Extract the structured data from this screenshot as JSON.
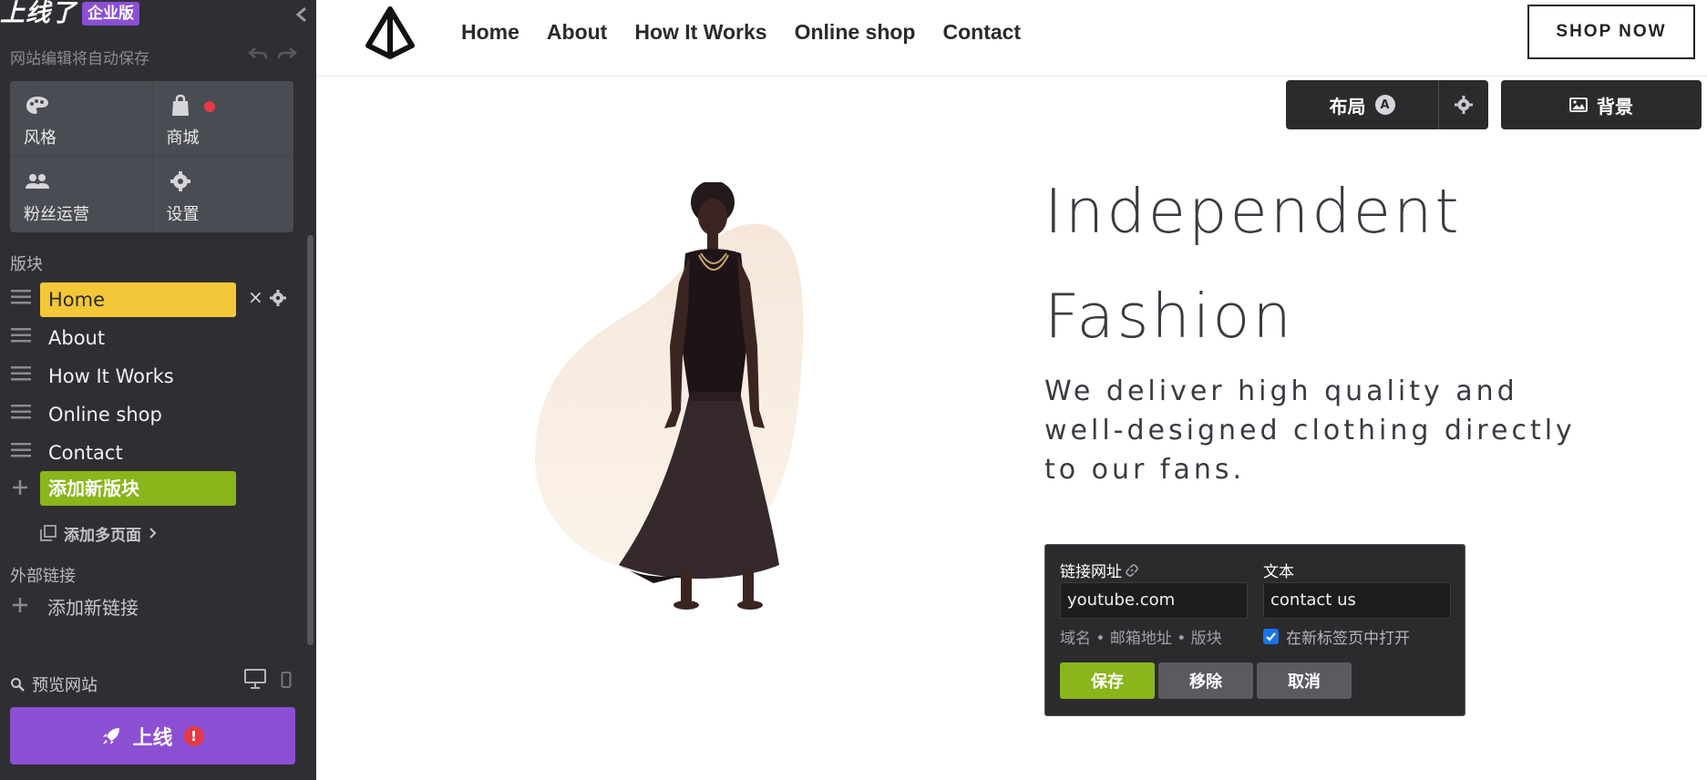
{
  "app": {
    "brand_name": "上线了",
    "brand_badge": "企业版",
    "autosave_text": "网站编辑将自动保存"
  },
  "tools": [
    {
      "label": "风格",
      "icon": "palette-icon"
    },
    {
      "label": "商城",
      "icon": "shopping-bag-icon",
      "notify": true
    },
    {
      "label": "粉丝运营",
      "icon": "people-icon"
    },
    {
      "label": "设置",
      "icon": "gear-icon"
    }
  ],
  "sections": {
    "blocks_label": "版块",
    "external_links_label": "外部链接"
  },
  "blocks": [
    {
      "label": "Home",
      "active": true
    },
    {
      "label": "About"
    },
    {
      "label": "How It Works"
    },
    {
      "label": "Online shop"
    },
    {
      "label": "Contact"
    }
  ],
  "actions": {
    "add_block": "添加新版块",
    "add_page": "添加多页面",
    "add_link": "添加新链接",
    "preview": "预览网站",
    "publish": "上线",
    "publish_alert": "!"
  },
  "site": {
    "nav": [
      "Home",
      "About",
      "How It Works",
      "Online shop",
      "Contact"
    ],
    "shop_now": "SHOP NOW",
    "layout_label": "布局",
    "layout_badge": "A",
    "background_label": "背景",
    "hero_title_line1": "Independent",
    "hero_title_line2": "Fashion",
    "hero_subtitle": "We deliver high quality and well-designed clothing directly to our fans."
  },
  "link_editor": {
    "url_label": "链接网址",
    "url_value": "youtube.com",
    "text_label": "文本",
    "text_value": "contact us",
    "hint": "域名 • 邮箱地址 • 版块",
    "new_tab_label": "在新标签页中打开",
    "new_tab_checked": true,
    "save": "保存",
    "remove": "移除",
    "cancel": "取消"
  },
  "colors": {
    "sidebar_bg": "#2f2f33",
    "brand_purple": "#8b4fd4",
    "active_yellow": "#f4c738",
    "add_green": "#8ab51b",
    "alert_red": "#e53945",
    "hero_text": "#3a3a42"
  }
}
